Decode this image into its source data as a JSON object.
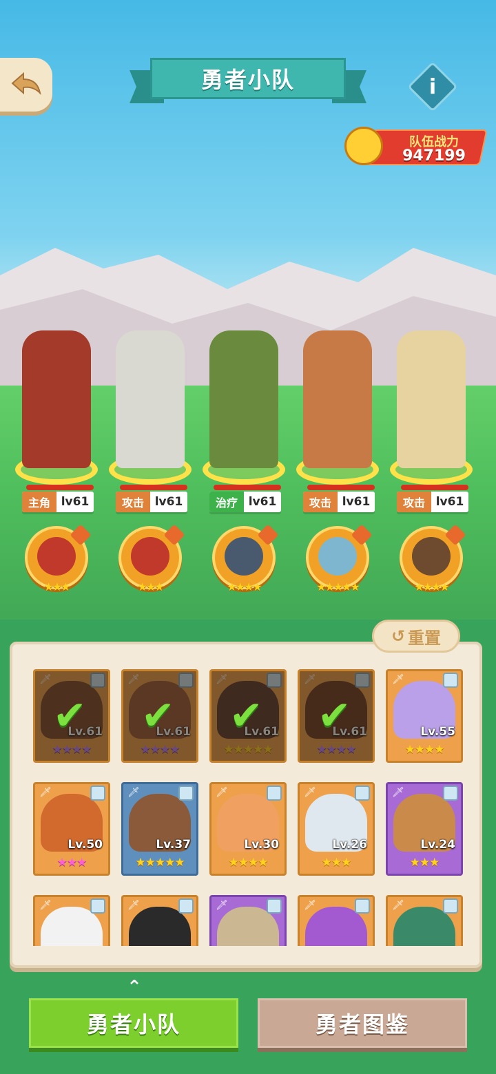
{
  "header": {
    "title": "勇者小队",
    "info_label": "i",
    "team_power_label": "队伍战力",
    "team_power_value": "947199"
  },
  "heroes": [
    {
      "role": "主角",
      "role_color": "#e0823a",
      "level": "lv61",
      "figure_color": "#a33a2a",
      "pet_color": "#c0392b",
      "pet_stars": "★★★"
    },
    {
      "role": "攻击",
      "role_color": "#e0823a",
      "level": "lv61",
      "figure_color": "#d9d9d2",
      "pet_color": "#c0392b",
      "pet_stars": "★★★"
    },
    {
      "role": "治疗",
      "role_color": "#3db24a",
      "level": "lv61",
      "figure_color": "#6a8a3e",
      "pet_color": "#4a5a6e",
      "pet_stars": "★★★★"
    },
    {
      "role": "攻击",
      "role_color": "#e0823a",
      "level": "lv61",
      "figure_color": "#c77a45",
      "pet_color": "#7fb6cf",
      "pet_stars": "★★★★★"
    },
    {
      "role": "攻击",
      "role_color": "#e0823a",
      "level": "lv61",
      "figure_color": "#e7d3a0",
      "pet_color": "#6e4a2e",
      "pet_stars": "★★★★"
    }
  ],
  "reset_label": "重置",
  "roster": [
    {
      "level": "Lv.61",
      "stars": "★★★★",
      "star_style": "violet",
      "card": "orange",
      "portrait": "#7a4a2a",
      "selected": true
    },
    {
      "level": "Lv.61",
      "stars": "★★★★",
      "star_style": "violet",
      "card": "orange",
      "portrait": "#9a5a38",
      "selected": true
    },
    {
      "level": "Lv.61",
      "stars": "★★★★★",
      "star_style": "gold",
      "card": "orange",
      "portrait": "#5a3a2a",
      "selected": true
    },
    {
      "level": "Lv.61",
      "stars": "★★★★",
      "star_style": "violet",
      "card": "orange",
      "portrait": "#6a3a22",
      "selected": true
    },
    {
      "level": "Lv.55",
      "stars": "★★★★",
      "star_style": "gold",
      "card": "orange",
      "portrait": "#b9a0e8",
      "selected": false
    },
    {
      "level": "Lv.50",
      "stars": "★★★",
      "star_style": "pink",
      "card": "orange",
      "portrait": "#d26a2e",
      "selected": false
    },
    {
      "level": "Lv.37",
      "stars": "★★★★★",
      "star_style": "gold",
      "card": "blue",
      "portrait": "#8a5a3a",
      "selected": false
    },
    {
      "level": "Lv.30",
      "stars": "★★★★",
      "star_style": "gold",
      "card": "orange",
      "portrait": "#f0a060",
      "selected": false
    },
    {
      "level": "Lv.26",
      "stars": "★★★",
      "star_style": "gold",
      "card": "orange",
      "portrait": "#dfe8ef",
      "selected": false
    },
    {
      "level": "Lv.24",
      "stars": "★★★",
      "star_style": "gold",
      "card": "purple",
      "portrait": "#c98a4a",
      "selected": false
    },
    {
      "level": "",
      "stars": "",
      "star_style": "gold",
      "card": "orange",
      "portrait": "#f2f2f2",
      "selected": false
    },
    {
      "level": "",
      "stars": "",
      "star_style": "gold",
      "card": "orange",
      "portrait": "#2a2a2a",
      "selected": false
    },
    {
      "level": "",
      "stars": "",
      "star_style": "gold",
      "card": "purple",
      "portrait": "#cbb892",
      "selected": false
    },
    {
      "level": "",
      "stars": "",
      "star_style": "gold",
      "card": "orange",
      "portrait": "#a35ad0",
      "selected": false
    },
    {
      "level": "",
      "stars": "",
      "star_style": "gold",
      "card": "orange",
      "portrait": "#3a8a6a",
      "selected": false
    }
  ],
  "tabs": {
    "team": "勇者小队",
    "codex": "勇者图鉴"
  }
}
